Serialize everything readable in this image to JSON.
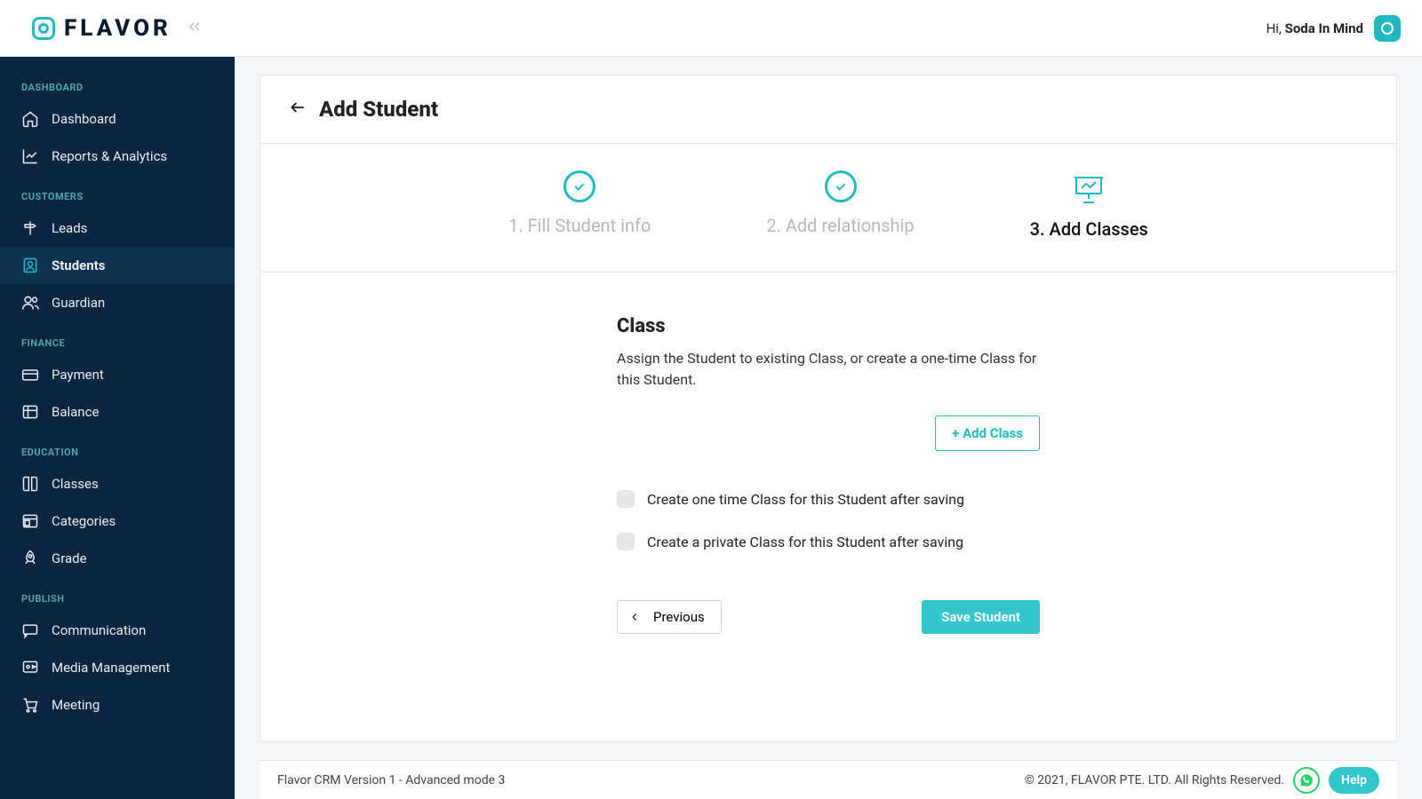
{
  "brand": {
    "name": "FLAVOR"
  },
  "header": {
    "greeting_prefix": "Hi, ",
    "user_name": "Soda In Mind"
  },
  "sidebar": {
    "sections": [
      {
        "label": "DASHBOARD",
        "items": [
          {
            "key": "dashboard",
            "label": "Dashboard",
            "icon": "home"
          },
          {
            "key": "reports",
            "label": "Reports & Analytics",
            "icon": "chart"
          }
        ]
      },
      {
        "label": "CUSTOMERS",
        "items": [
          {
            "key": "leads",
            "label": "Leads",
            "icon": "signpost"
          },
          {
            "key": "students",
            "label": "Students",
            "icon": "person",
            "active": true
          },
          {
            "key": "guardian",
            "label": "Guardian",
            "icon": "users"
          }
        ]
      },
      {
        "label": "FINANCE",
        "items": [
          {
            "key": "payment",
            "label": "Payment",
            "icon": "card"
          },
          {
            "key": "balance",
            "label": "Balance",
            "icon": "table"
          }
        ]
      },
      {
        "label": "EDUCATION",
        "items": [
          {
            "key": "classes",
            "label": "Classes",
            "icon": "book"
          },
          {
            "key": "categories",
            "label": "Categories",
            "icon": "browser"
          },
          {
            "key": "grade",
            "label": "Grade",
            "icon": "rocket"
          }
        ]
      },
      {
        "label": "PUBLISH",
        "items": [
          {
            "key": "communication",
            "label": "Communication",
            "icon": "comment"
          },
          {
            "key": "media",
            "label": "Media Management",
            "icon": "video"
          },
          {
            "key": "meeting",
            "label": "Meeting",
            "icon": "cart"
          }
        ]
      }
    ]
  },
  "page": {
    "title": "Add Student",
    "steps": [
      {
        "label": "1. Fill Student info",
        "state": "done"
      },
      {
        "label": "2. Add relationship",
        "state": "done"
      },
      {
        "label": "3. Add Classes",
        "state": "current"
      }
    ],
    "class_section": {
      "heading": "Class",
      "description": "Assign the Student to existing Class, or create a one-time Class for this Student.",
      "add_class_label": "+ Add Class",
      "checkbox1": "Create one time Class for this Student after saving",
      "checkbox2": "Create a private Class for this Student after saving"
    },
    "actions": {
      "previous": "Previous",
      "save": "Save Student"
    }
  },
  "footer": {
    "version": "Flavor CRM Version 1 - Advanced mode 3",
    "copyright": "© 2021, FLAVOR PTE. LTD. All Rights Reserved.",
    "help": "Help"
  }
}
